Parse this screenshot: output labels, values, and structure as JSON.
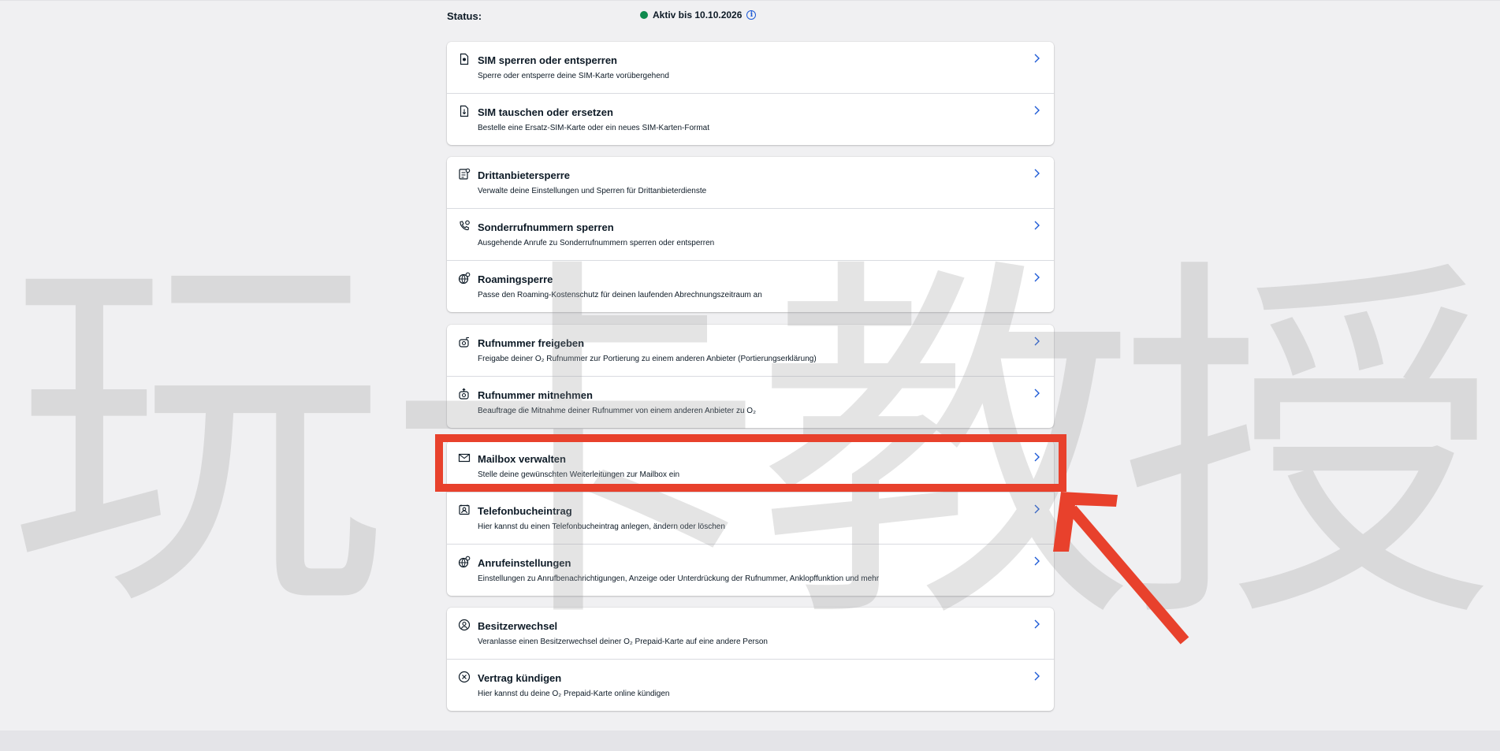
{
  "status": {
    "label": "Status:",
    "value": "Aktiv bis 10.10.2026",
    "info_icon": "info-icon",
    "dot_color": "#0e8a4d"
  },
  "groups": [
    {
      "items": [
        {
          "icon": "sim-lock-icon",
          "title": "SIM sperren oder entsperren",
          "desc": "Sperre oder entsperre deine SIM-Karte vorübergehend"
        },
        {
          "icon": "sim-swap-icon",
          "title": "SIM tauschen oder ersetzen",
          "desc": "Bestelle eine Ersatz-SIM-Karte oder ein neues SIM-Karten-Format"
        }
      ]
    },
    {
      "items": [
        {
          "icon": "third-party-block-icon",
          "title": "Drittanbietersperre",
          "desc": "Verwalte deine Einstellungen und Sperren für Drittanbieterdienste"
        },
        {
          "icon": "phone-block-icon",
          "title": "Sonderrufnummern sperren",
          "desc": "Ausgehende Anrufe zu Sonderrufnummern sperren oder entsperren"
        },
        {
          "icon": "globe-roaming-icon",
          "title": "Roamingsperre",
          "desc": "Passe den Roaming-Kostenschutz für deinen laufenden Abrechnungszeitraum an"
        }
      ]
    },
    {
      "items": [
        {
          "icon": "number-release-icon",
          "title": "Rufnummer freigeben",
          "desc": "Freigabe deiner O₂ Rufnummer zur Portierung zu einem anderen Anbieter (Portierungserklärung)"
        },
        {
          "icon": "number-port-icon",
          "title": "Rufnummer mitnehmen",
          "desc": "Beauftrage die Mitnahme deiner Rufnummer von einem anderen Anbieter zu O₂"
        }
      ]
    },
    {
      "items": [
        {
          "icon": "mail-icon",
          "title": "Mailbox verwalten",
          "desc": "Stelle deine gewünschten Weiterleitungen zur Mailbox ein"
        },
        {
          "icon": "phonebook-icon",
          "title": "Telefonbucheintrag",
          "desc": "Hier kannst du einen Telefonbucheintrag anlegen, ändern oder löschen"
        },
        {
          "icon": "call-settings-icon",
          "title": "Anrufeinstellungen",
          "desc": "Einstellungen zu Anrufbenachrichtigungen, Anzeige oder Unterdrückung der Rufnummer, Anklopffunktion und mehr"
        }
      ]
    },
    {
      "items": [
        {
          "icon": "owner-change-icon",
          "title": "Besitzerwechsel",
          "desc": "Veranlasse einen Besitzerwechsel deiner O₂ Prepaid-Karte auf eine andere Person"
        },
        {
          "icon": "cancel-circle-icon",
          "title": "Vertrag kündigen",
          "desc": "Hier kannst du deine O₂ Prepaid-Karte online kündigen"
        }
      ]
    }
  ],
  "watermark": {
    "chars": [
      "玩",
      "卡",
      "教",
      "授"
    ]
  },
  "colors": {
    "chevron": "#1d5ad6",
    "annotation": "#e8412c"
  }
}
